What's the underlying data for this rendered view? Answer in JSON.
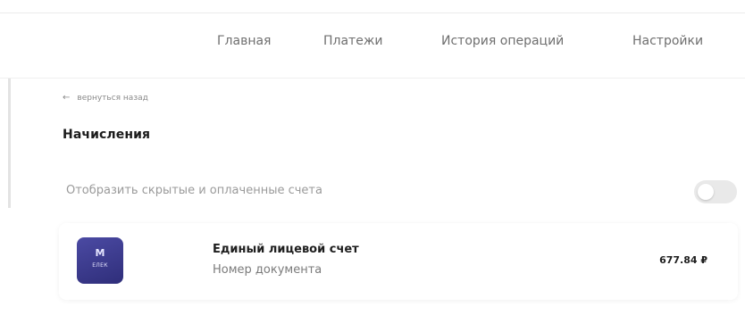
{
  "nav": {
    "items": [
      {
        "label": "Главная"
      },
      {
        "label": "Платежи"
      },
      {
        "label": "История операций"
      },
      {
        "label": "Настройки"
      }
    ]
  },
  "back": {
    "label": "вернуться назад",
    "icon": "arrow-left-icon"
  },
  "page": {
    "title": "Начисления"
  },
  "filter": {
    "label": "Отобразить скрытые и оплаченные счета",
    "toggle_state": "off"
  },
  "bill": {
    "logo_mark": "М",
    "logo_sub": "ЕЛЕК",
    "title": "Единый лицевой счет",
    "subtitle": "Номер документа",
    "amount": "677.84 ₽"
  },
  "colors": {
    "logo_bg": "#3b3a8c",
    "toggle_bg": "#e9e9e9",
    "nav_text": "#6f6f6f"
  }
}
